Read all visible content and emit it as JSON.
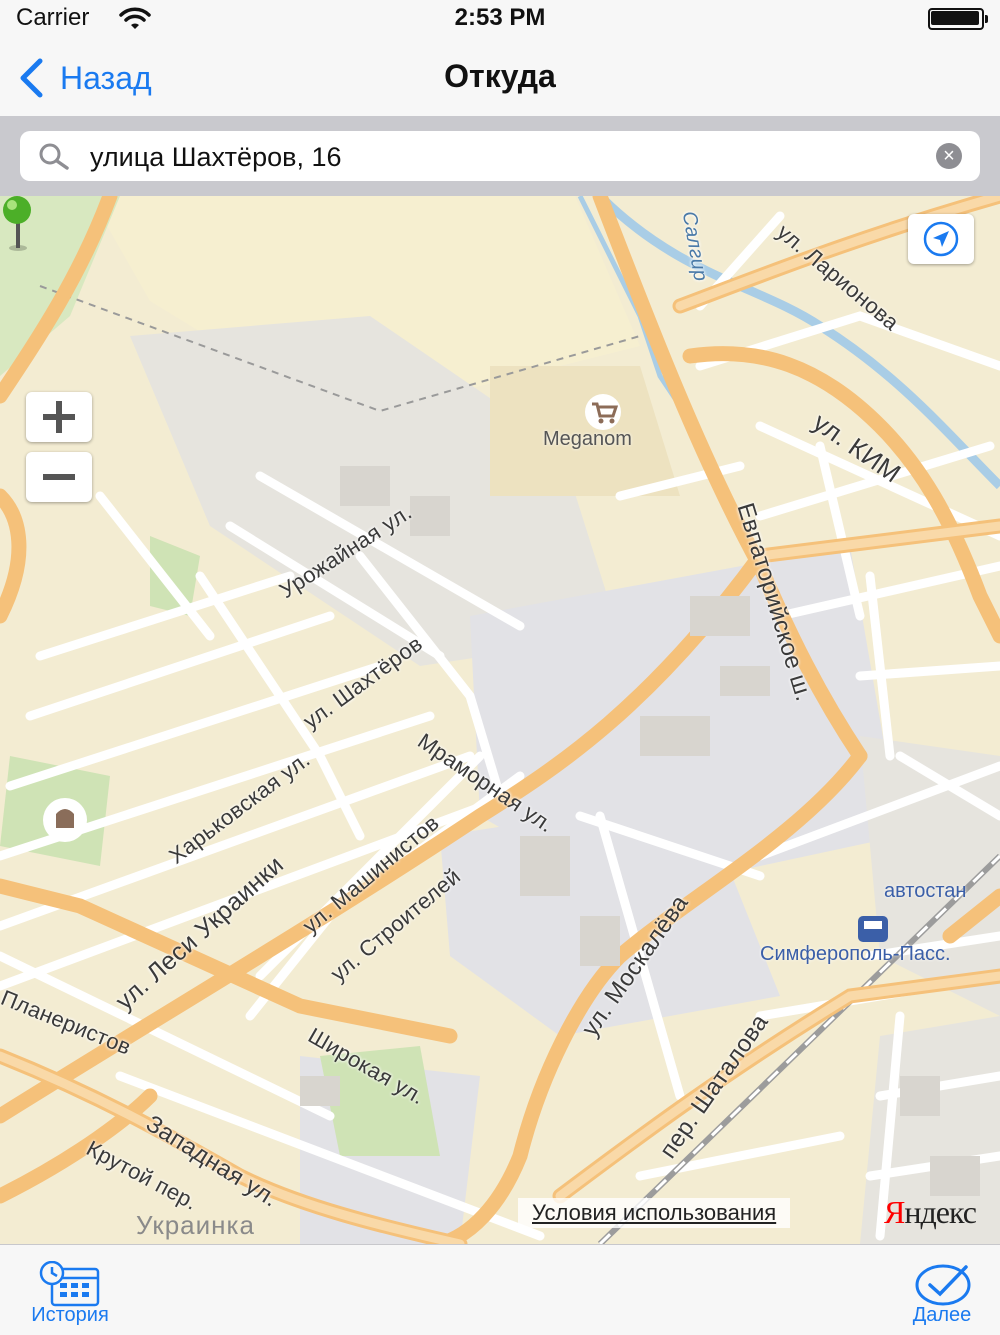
{
  "status_bar": {
    "carrier": "Carrier",
    "time": "2:53 PM"
  },
  "nav": {
    "back_label": "Назад",
    "title": "Откуда"
  },
  "search": {
    "value": "улица Шахтёров, 16"
  },
  "map": {
    "streets": {
      "urozhaynaya": "Урожайная ул.",
      "shakhterov": "ул. Шахтёров",
      "kharkovskaya": "Харьковская ул.",
      "mramornaya": "Мраморная ул.",
      "lesi_ukrainki": "ул. Леси Украинки",
      "mashinistov": "ул. Машинистов",
      "stroiteley": "ул. Строителей",
      "shirokaya": "Широкая ул.",
      "planeristov": "Планеристов",
      "zapadnaya": "Западная ул.",
      "krutoy": "Крутой пер.",
      "moskaleva": "ул. Москалёва",
      "shatalova": "пер. Шаталова",
      "evpatoriyskoe": "Евпаторийское ш.",
      "kim": "ул. КИМ",
      "larionova": "ул. Ларионова",
      "salgir": "Салгир"
    },
    "poi_meganom": "Meganom",
    "district": "Украинка",
    "station": "Симферополь-Пасс.",
    "bus_station": "автостан",
    "terms": "Условия использования",
    "brand_first": "Я",
    "brand_rest": "ндекс"
  },
  "tabs": {
    "history": "История",
    "next": "Далее"
  },
  "colors": {
    "accent": "#1a7af0",
    "road_major": "#f7b75c",
    "pin": "#4caf28"
  }
}
